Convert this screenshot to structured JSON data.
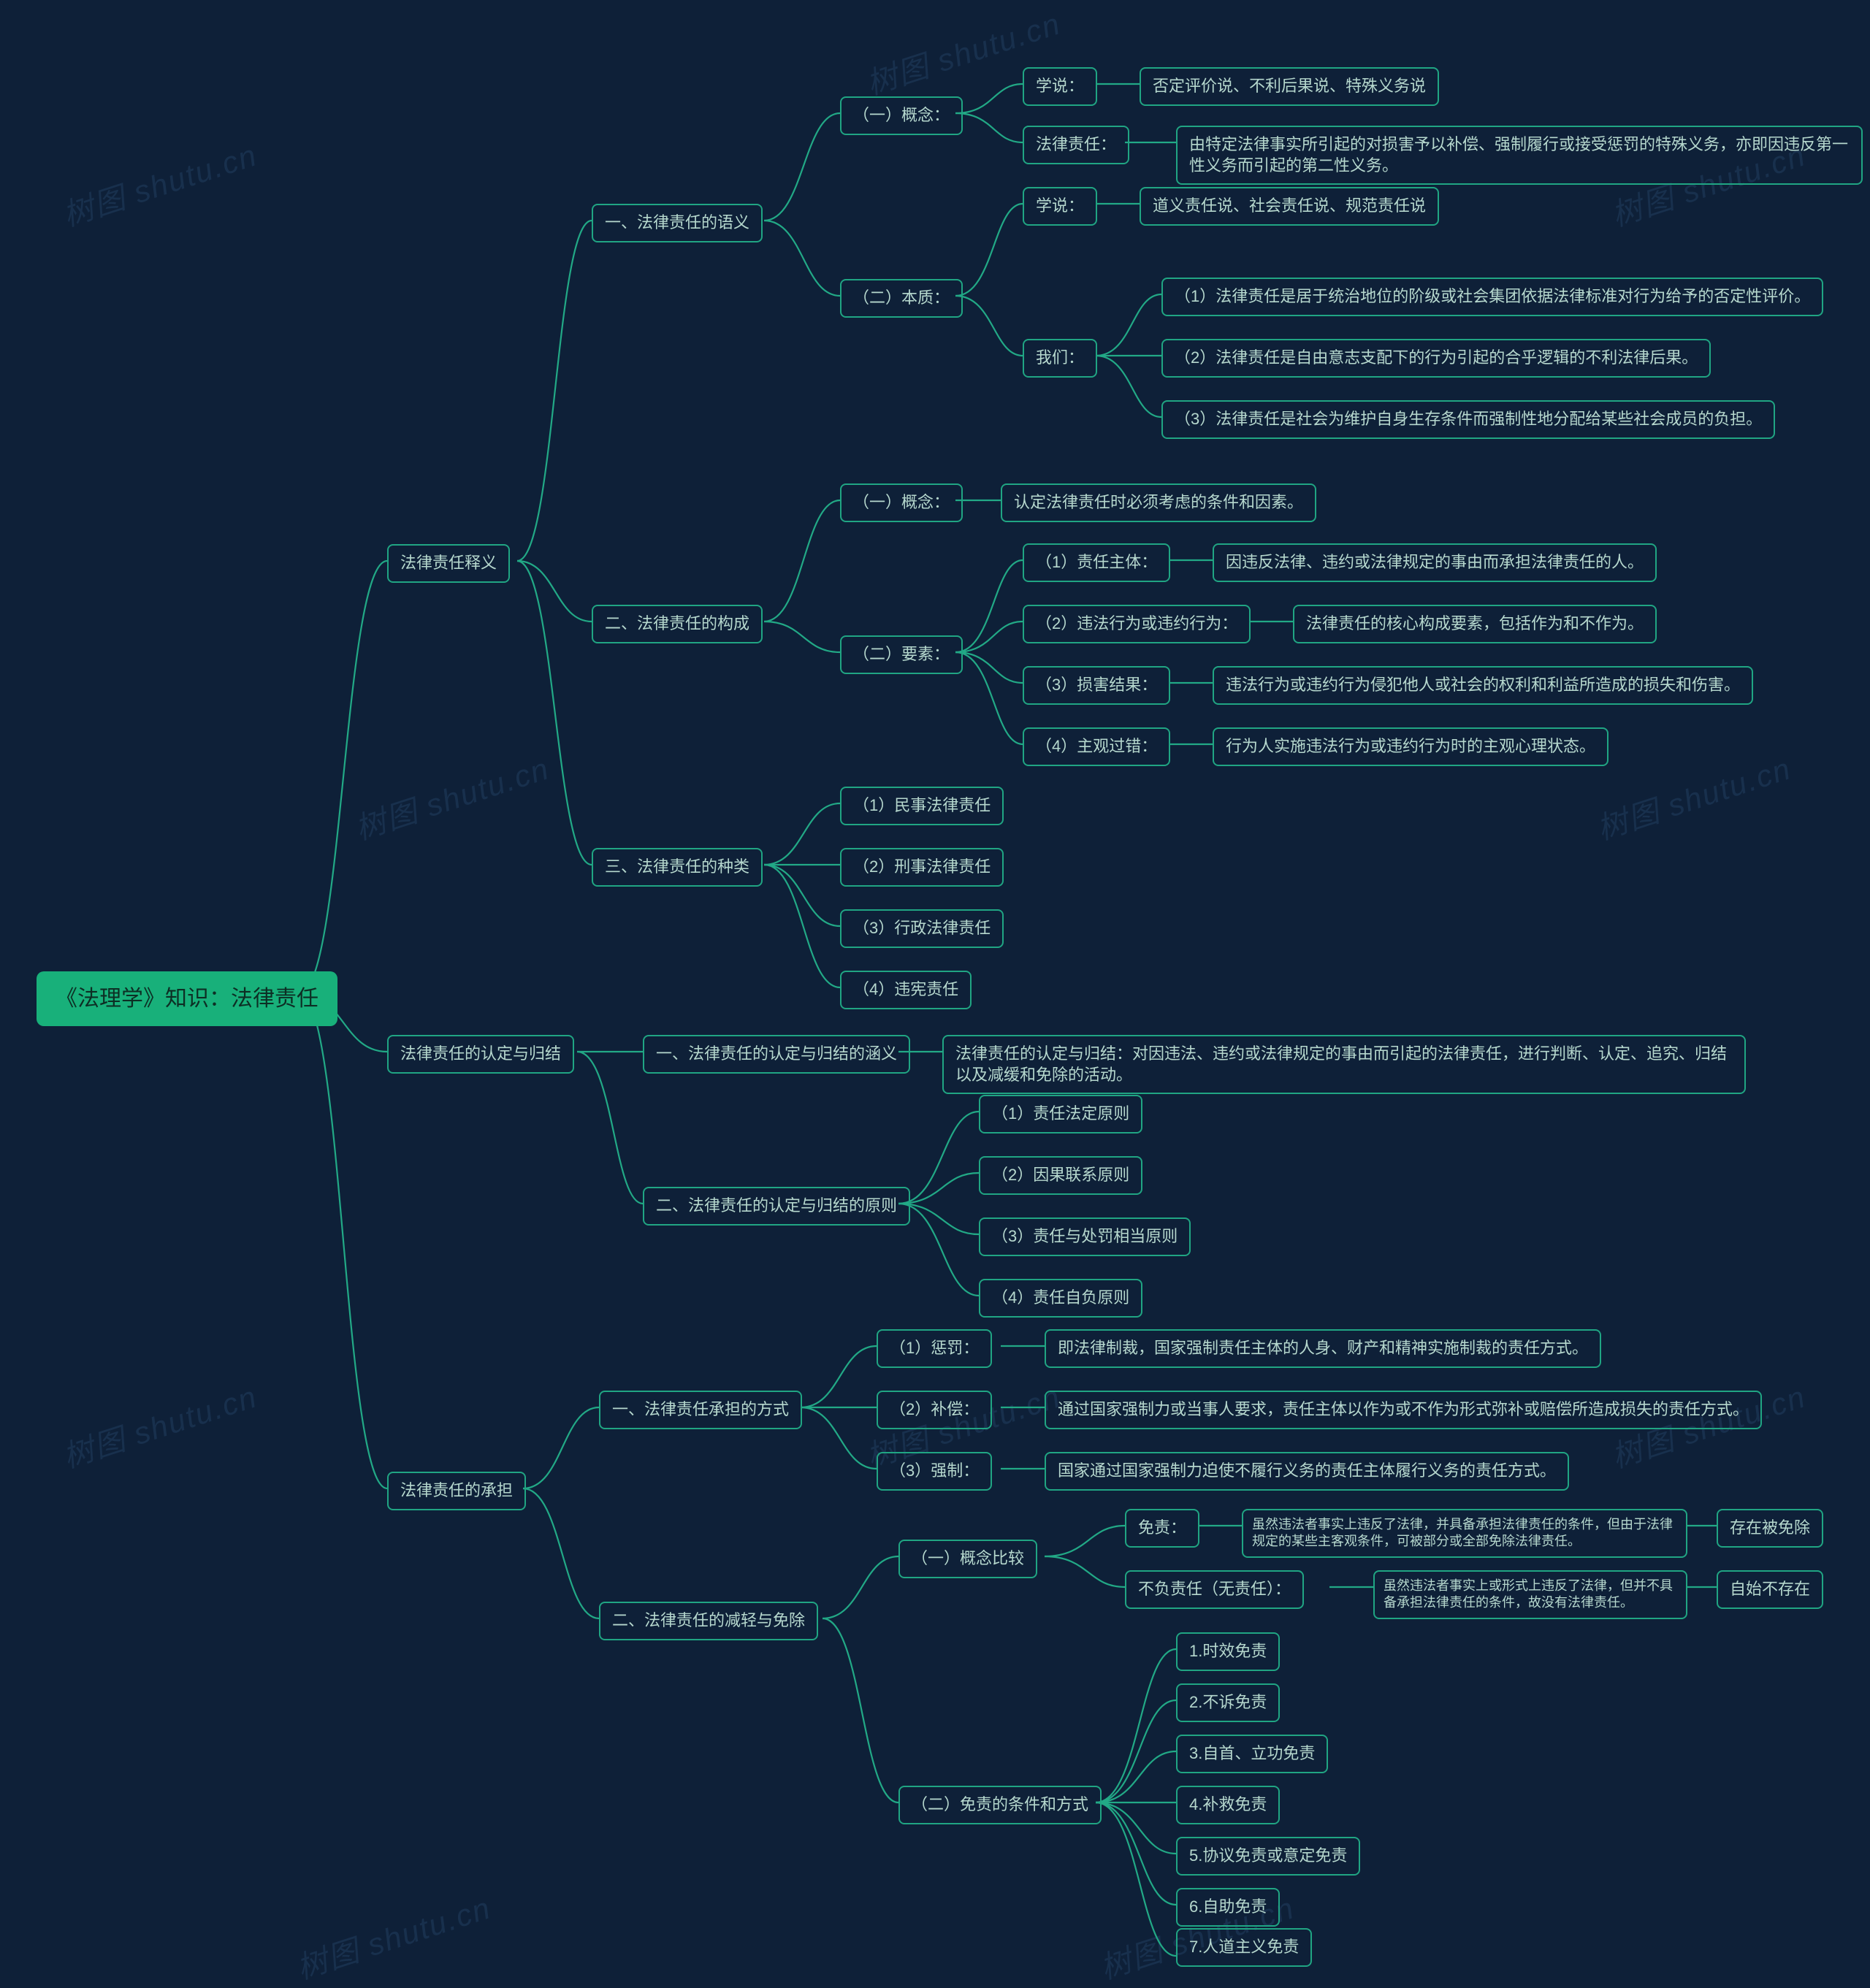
{
  "watermark_text": "树图 shutu.cn",
  "root": "《法理学》知识：法律责任",
  "s1": "法律责任释义",
  "s1_1": "一、法律责任的语义",
  "s1_1_1": "（一）概念：",
  "s1_1_1_a": "学说：",
  "s1_1_1_a_v": "否定评价说、不利后果说、特殊义务说",
  "s1_1_1_b": "法律责任：",
  "s1_1_1_b_v": "由特定法律事实所引起的对损害予以补偿、强制履行或接受惩罚的特殊义务，亦即因违反第一性义务而引起的第二性义务。",
  "s1_1_2": "（二）本质：",
  "s1_1_2_a": "学说：",
  "s1_1_2_a_v": "道义责任说、社会责任说、规范责任说",
  "s1_1_2_b": "我们：",
  "s1_1_2_b_1": "（1）法律责任是居于统治地位的阶级或社会集团依据法律标准对行为给予的否定性评价。",
  "s1_1_2_b_2": "（2）法律责任是自由意志支配下的行为引起的合乎逻辑的不利法律后果。",
  "s1_1_2_b_3": "（3）法律责任是社会为维护自身生存条件而强制性地分配给某些社会成员的负担。",
  "s1_2": "二、法律责任的构成",
  "s1_2_1": "（一）概念：",
  "s1_2_1_v": "认定法律责任时必须考虑的条件和因素。",
  "s1_2_2": "（二）要素：",
  "s1_2_2_1": "（1）责任主体：",
  "s1_2_2_1_v": "因违反法律、违约或法律规定的事由而承担法律责任的人。",
  "s1_2_2_2": "（2）违法行为或违约行为：",
  "s1_2_2_2_v": "法律责任的核心构成要素，包括作为和不作为。",
  "s1_2_2_3": "（3）损害结果：",
  "s1_2_2_3_v": "违法行为或违约行为侵犯他人或社会的权利和利益所造成的损失和伤害。",
  "s1_2_2_4": "（4）主观过错：",
  "s1_2_2_4_v": "行为人实施违法行为或违约行为时的主观心理状态。",
  "s1_3": "三、法律责任的种类",
  "s1_3_1": "（1）民事法律责任",
  "s1_3_2": "（2）刑事法律责任",
  "s1_3_3": "（3）行政法律责任",
  "s1_3_4": "（4）违宪责任",
  "s2": "法律责任的认定与归结",
  "s2_1": "一、法律责任的认定与归结的涵义",
  "s2_1_v": "法律责任的认定与归结：对因违法、违约或法律规定的事由而引起的法律责任，进行判断、认定、追究、归结以及减缓和免除的活动。",
  "s2_2": "二、法律责任的认定与归结的原则",
  "s2_2_1": "（1）责任法定原则",
  "s2_2_2": "（2）因果联系原则",
  "s2_2_3": "（3）责任与处罚相当原则",
  "s2_2_4": "（4）责任自负原则",
  "s3": "法律责任的承担",
  "s3_1": "一、法律责任承担的方式",
  "s3_1_1": "（1）惩罚：",
  "s3_1_1_v": "即法律制裁，国家强制责任主体的人身、财产和精神实施制裁的责任方式。",
  "s3_1_2": "（2）补偿：",
  "s3_1_2_v": "通过国家强制力或当事人要求，责任主体以作为或不作为形式弥补或赔偿所造成损失的责任方式。",
  "s3_1_3": "（3）强制：",
  "s3_1_3_v": "国家通过国家强制力迫使不履行义务的责任主体履行义务的责任方式。",
  "s3_2": "二、法律责任的减轻与免除",
  "s3_2_1": "（一）概念比较",
  "s3_2_1_a": "免责：",
  "s3_2_1_a_v": "虽然违法者事实上违反了法律，并具备承担法律责任的条件，但由于法律规定的某些主客观条件，可被部分或全部免除法律责任。",
  "s3_2_1_a_t": "存在被免除",
  "s3_2_1_b": "不负责任（无责任）：",
  "s3_2_1_b_v": "虽然违法者事实上或形式上违反了法律，但并不具备承担法律责任的条件，故没有法律责任。",
  "s3_2_1_b_t": "自始不存在",
  "s3_2_2": "（二）免责的条件和方式",
  "s3_2_2_1": "1.时效免责",
  "s3_2_2_2": "2.不诉免责",
  "s3_2_2_3": "3.自首、立功免责",
  "s3_2_2_4": "4.补救免责",
  "s3_2_2_5": "5.协议免责或意定免责",
  "s3_2_2_6": "6.自助免责",
  "s3_2_2_7": "7.人道主义免责"
}
